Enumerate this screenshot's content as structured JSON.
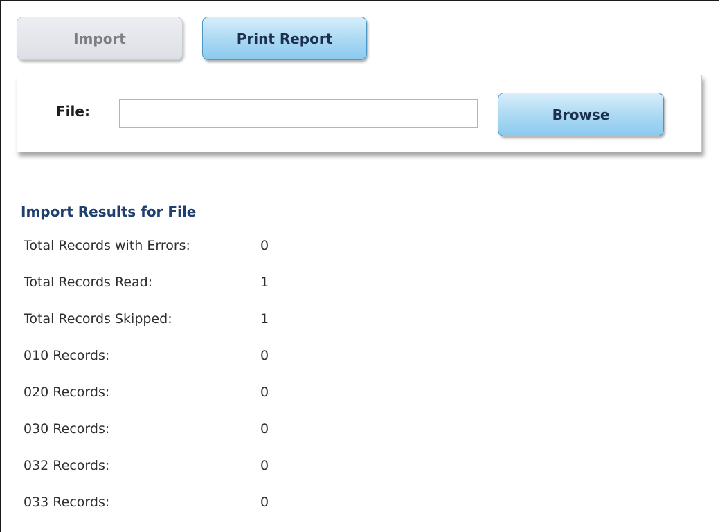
{
  "toolbar": {
    "import_label": "Import",
    "print_report_label": "Print Report"
  },
  "file_panel": {
    "label": "File:",
    "value": "",
    "placeholder": "",
    "browse_label": "Browse"
  },
  "results": {
    "title": "Import Results for File",
    "rows": [
      {
        "label": "Total Records with Errors:",
        "value": "0"
      },
      {
        "label": "Total Records Read:",
        "value": "1"
      },
      {
        "label": "Total Records Skipped:",
        "value": "1"
      },
      {
        "label": "010 Records:",
        "value": "0"
      },
      {
        "label": "020 Records:",
        "value": "0"
      },
      {
        "label": "030 Records:",
        "value": "0"
      },
      {
        "label": "032 Records:",
        "value": "0"
      },
      {
        "label": "033 Records:",
        "value": "0"
      }
    ]
  }
}
